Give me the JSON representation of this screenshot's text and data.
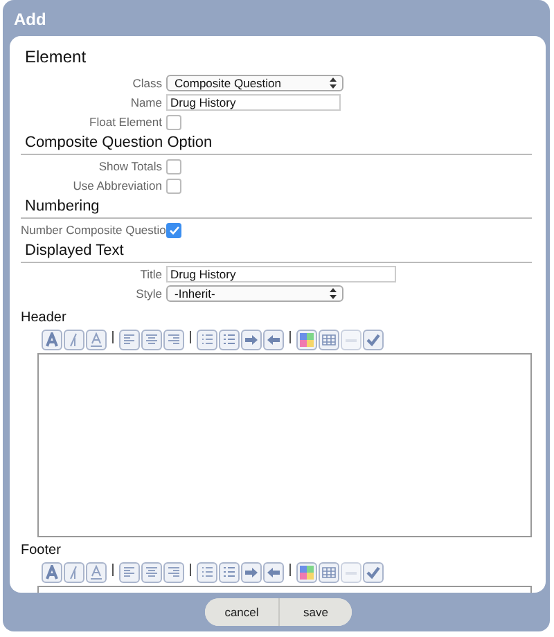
{
  "window": {
    "title": "Add"
  },
  "sections": [
    {
      "heading": "Element",
      "underlined": false,
      "fields": [
        {
          "kind": "select",
          "label": "Class",
          "value": "Composite Question"
        },
        {
          "kind": "text",
          "label": "Name",
          "value": "Drug History"
        },
        {
          "kind": "checkbox",
          "label": "Float Element",
          "checked": false
        }
      ]
    },
    {
      "heading": "Composite Question Option",
      "underlined": true,
      "fields": [
        {
          "kind": "checkbox",
          "label": "Show Totals",
          "checked": false
        },
        {
          "kind": "checkbox",
          "label": "Use Abbreviation",
          "checked": false
        }
      ]
    },
    {
      "heading": "Numbering",
      "underlined": true,
      "fields": [
        {
          "kind": "checkbox",
          "label": "Number Composite Questio",
          "checked": true
        }
      ]
    },
    {
      "heading": "Displayed Text",
      "underlined": true,
      "fields": [
        {
          "kind": "wide-text",
          "label": "Title",
          "value": "Drug History"
        },
        {
          "kind": "select",
          "label": "Style",
          "value": "-Inherit-"
        }
      ]
    }
  ],
  "editors": [
    {
      "label": "Header"
    },
    {
      "label": "Footer"
    }
  ],
  "buttons": [
    "cancel",
    "save"
  ]
}
